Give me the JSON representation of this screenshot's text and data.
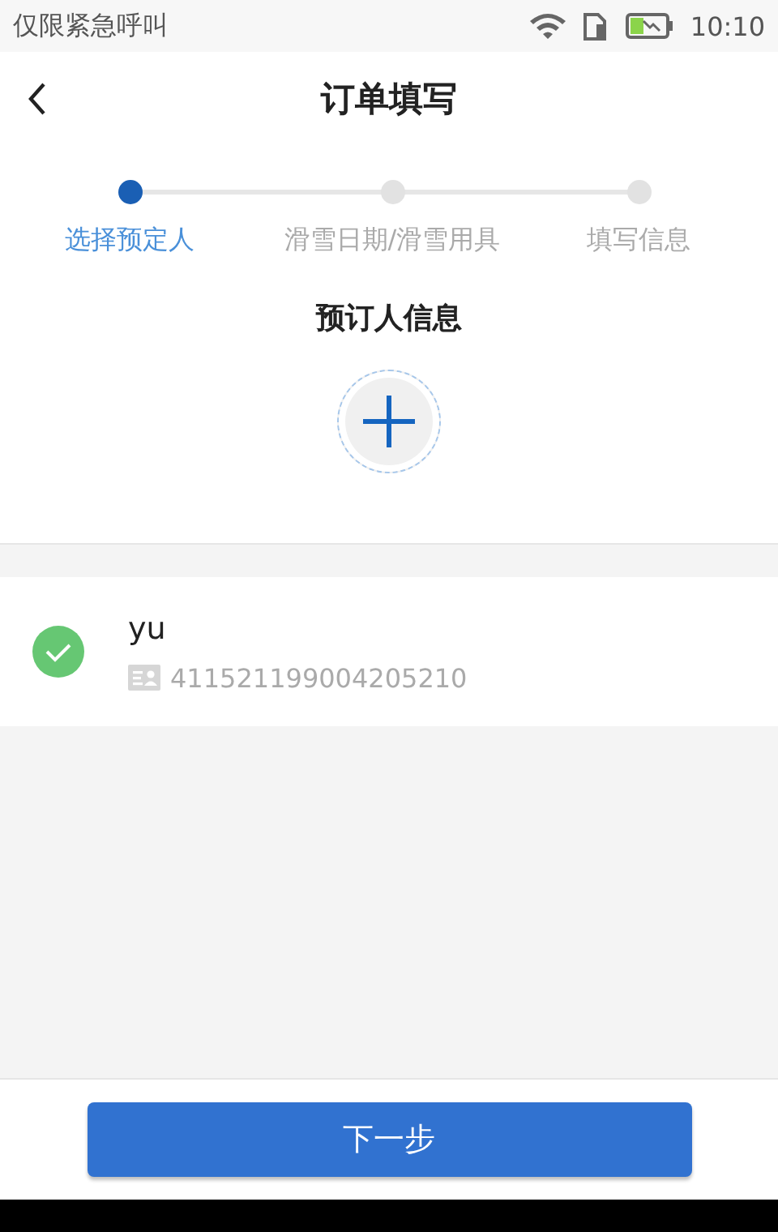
{
  "status_bar": {
    "carrier_text": "仅限紧急呼叫",
    "time": "10:10"
  },
  "header": {
    "title": "订单填写"
  },
  "steps": [
    {
      "label": "选择预定人",
      "selected": true
    },
    {
      "label": "滑雪日期/滑雪用具",
      "selected": false
    },
    {
      "label": "填写信息",
      "selected": false
    }
  ],
  "section_title": "预订人信息",
  "persons": [
    {
      "name": "yu",
      "id_number": "411521199004205210",
      "selected": true
    }
  ],
  "next_button": "下一步"
}
